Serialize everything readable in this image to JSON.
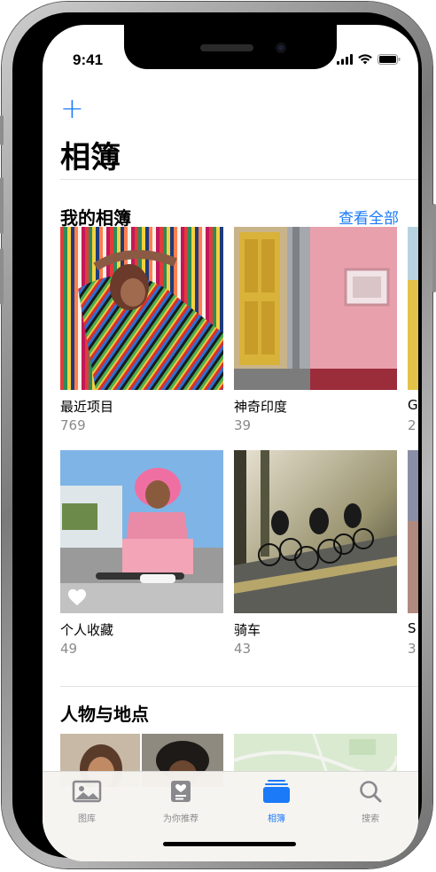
{
  "status_bar": {
    "time": "9:41"
  },
  "header": {
    "add_icon": "plus-icon",
    "title": "相簿"
  },
  "my_albums": {
    "title": "我的相簿",
    "see_all": "查看全部",
    "items": [
      {
        "label": "最近项目",
        "count": "769"
      },
      {
        "label": "神奇印度",
        "count": "39"
      },
      {
        "label": "G",
        "count": "2"
      },
      {
        "label": "个人收藏",
        "count": "49"
      },
      {
        "label": "骑车",
        "count": "43"
      },
      {
        "label": "S",
        "count": "3"
      }
    ]
  },
  "people_places": {
    "title": "人物与地点"
  },
  "tab_bar": {
    "tabs": [
      {
        "label": "图库",
        "icon": "photo-library-icon"
      },
      {
        "label": "为你推荐",
        "icon": "for-you-icon"
      },
      {
        "label": "相簿",
        "icon": "albums-icon",
        "active": true
      },
      {
        "label": "搜索",
        "icon": "search-icon"
      }
    ]
  },
  "colors": {
    "accent": "#1a7af8",
    "secondary_text": "#8a8a8e"
  }
}
